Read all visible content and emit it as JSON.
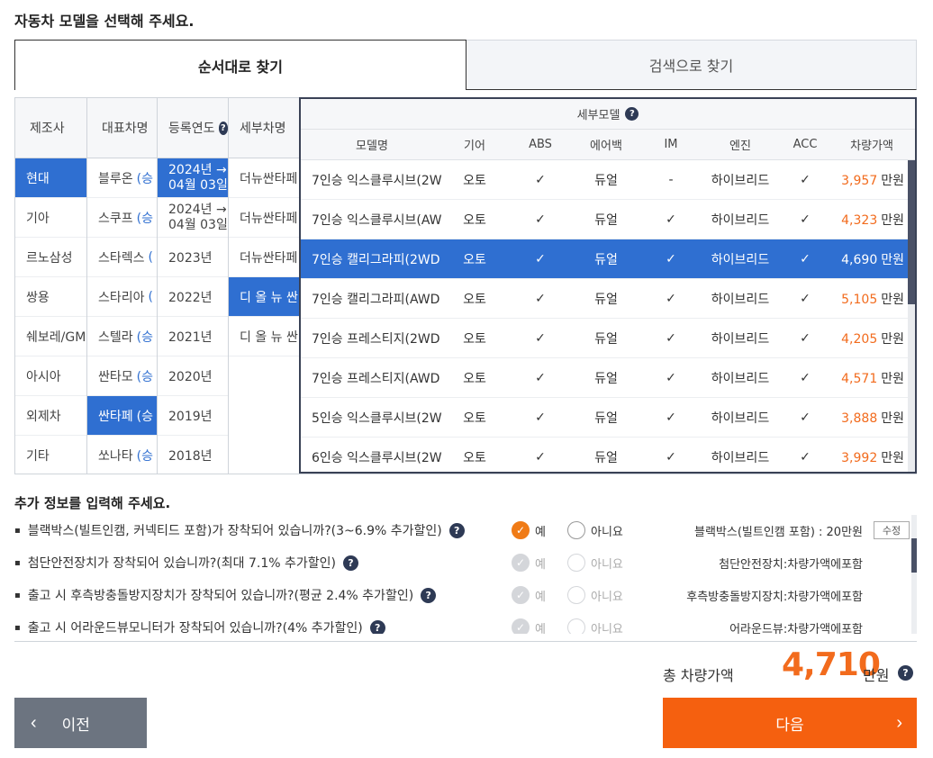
{
  "page_title": "자동차 모델을 선택해 주세요.",
  "tabs": [
    {
      "label": "순서대로 찾기",
      "active": true
    },
    {
      "label": "검색으로 찾기",
      "active": false
    }
  ],
  "columns": {
    "maker": {
      "header": "제조사",
      "items": [
        "현대",
        "기아",
        "르노삼성",
        "쌍용",
        "쉐보레/GM",
        "아시아",
        "외제차",
        "기타"
      ],
      "selected_index": 0
    },
    "model": {
      "header": "대표차명",
      "items": [
        {
          "name": "블루온",
          "sub": "(승"
        },
        {
          "name": "스쿠프",
          "sub": "(승"
        },
        {
          "name": "스타렉스",
          "sub": "("
        },
        {
          "name": "스타리아",
          "sub": "("
        },
        {
          "name": "스텔라",
          "sub": "(승"
        },
        {
          "name": "싼타모",
          "sub": "(승"
        },
        {
          "name": "싼타페",
          "sub": "(승"
        },
        {
          "name": "쏘나타",
          "sub": "(승"
        }
      ],
      "selected_index": 6
    },
    "year": {
      "header": "등록연도",
      "help_icon": "question-circle-icon",
      "items": [
        {
          "line1": "2024년 →",
          "line2": "04월 03일"
        },
        {
          "line1": "2024년 →",
          "line2": "04월 03일"
        },
        {
          "line1": "2023년"
        },
        {
          "line1": "2022년"
        },
        {
          "line1": "2021년"
        },
        {
          "line1": "2020년"
        },
        {
          "line1": "2019년"
        },
        {
          "line1": "2018년"
        }
      ],
      "selected_index": 0
    },
    "submodel": {
      "header": "세부차명",
      "items": [
        "더뉴싼타페",
        "더뉴싼타페",
        "더뉴싼타페",
        "디 올 뉴 싼",
        "디 올 뉴 싼"
      ],
      "selected_index": 3
    }
  },
  "detail": {
    "title": "세부모델",
    "help_icon": "question-circle-icon",
    "headers": {
      "name": "모델명",
      "gear": "기어",
      "abs": "ABS",
      "airbag": "에어백",
      "im": "IM",
      "engine": "엔진",
      "acc": "ACC",
      "price": "차량가액"
    },
    "price_unit": "만원",
    "rows": [
      {
        "name": "7인승 익스클루시브(2W",
        "gear": "오토",
        "abs": "✓",
        "airbag": "듀얼",
        "im": "-",
        "engine": "하이브리드",
        "acc": "✓",
        "price": "3,957"
      },
      {
        "name": "7인승 익스클루시브(AW",
        "gear": "오토",
        "abs": "✓",
        "airbag": "듀얼",
        "im": "✓",
        "engine": "하이브리드",
        "acc": "✓",
        "price": "4,323"
      },
      {
        "name": "7인승 캘리그라피(2WD",
        "gear": "오토",
        "abs": "✓",
        "airbag": "듀얼",
        "im": "✓",
        "engine": "하이브리드",
        "acc": "✓",
        "price": "4,690"
      },
      {
        "name": "7인승 캘리그라피(AWD",
        "gear": "오토",
        "abs": "✓",
        "airbag": "듀얼",
        "im": "✓",
        "engine": "하이브리드",
        "acc": "✓",
        "price": "5,105"
      },
      {
        "name": "7인승 프레스티지(2WD",
        "gear": "오토",
        "abs": "✓",
        "airbag": "듀얼",
        "im": "✓",
        "engine": "하이브리드",
        "acc": "✓",
        "price": "4,205"
      },
      {
        "name": "7인승 프레스티지(AWD",
        "gear": "오토",
        "abs": "✓",
        "airbag": "듀얼",
        "im": "✓",
        "engine": "하이브리드",
        "acc": "✓",
        "price": "4,571"
      },
      {
        "name": "5인승 익스클루시브(2W",
        "gear": "오토",
        "abs": "✓",
        "airbag": "듀얼",
        "im": "✓",
        "engine": "하이브리드",
        "acc": "✓",
        "price": "3,888"
      },
      {
        "name": "6인승 익스클루시브(2W",
        "gear": "오토",
        "abs": "✓",
        "airbag": "듀얼",
        "im": "✓",
        "engine": "하이브리드",
        "acc": "✓",
        "price": "3,992"
      }
    ],
    "selected_index": 2
  },
  "extra": {
    "title": "추가 정보를 입력해 주세요.",
    "yes_label": "예",
    "no_label": "아니요",
    "edit_label": "수정",
    "questions": [
      {
        "text": "블랙박스(빌트인캠, 커넥티드 포함)가 장착되어 있습니까?(3~6.9% 추가할인)",
        "state": "yes",
        "disabled": false,
        "value": "블랙박스(빌트인캠 포함) : 20만원",
        "has_edit": true
      },
      {
        "text": "첨단안전장치가 장착되어 있습니까?(최대 7.1% 추가할인)",
        "state": "yes",
        "disabled": true,
        "value": "첨단안전장치:차량가액에포함",
        "has_edit": false
      },
      {
        "text": "출고 시 후측방충돌방지장치가 장착되어 있습니까?(평균 2.4% 추가할인)",
        "state": "yes",
        "disabled": true,
        "value": "후측방충돌방지장치:차량가액에포함",
        "has_edit": false
      },
      {
        "text": "출고 시 어라운드뷰모니터가 장착되어 있습니까?(4% 추가할인)",
        "state": "yes",
        "disabled": true,
        "value": "어라운드뷰:차량가액에포함",
        "has_edit": false
      }
    ]
  },
  "total": {
    "label": "총 차량가액",
    "value": "4,710",
    "unit": "만원"
  },
  "buttons": {
    "prev": "이전",
    "next": "다음"
  },
  "colors": {
    "accent_orange": "#f5600f",
    "select_blue": "#2f6fd1",
    "navy": "#2e3a55"
  }
}
